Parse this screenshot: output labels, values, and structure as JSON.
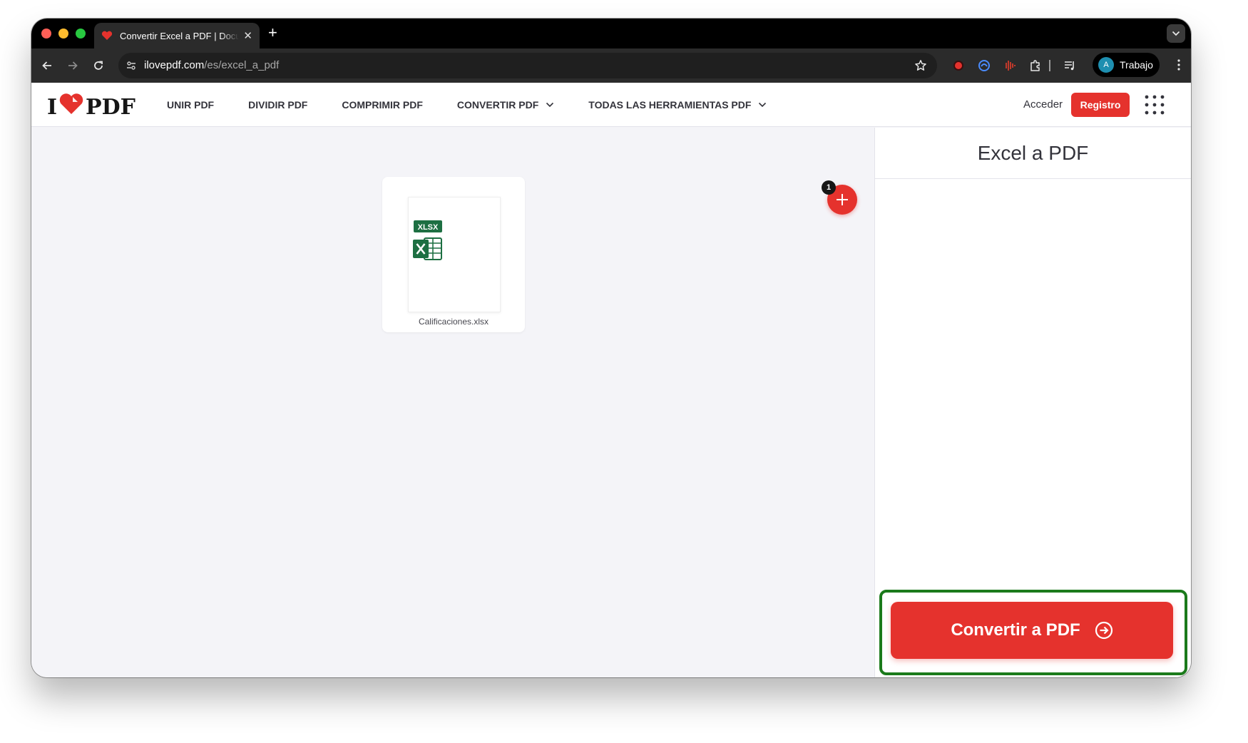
{
  "browser": {
    "tab_title": "Convertir Excel a PDF | Documentos Excel",
    "new_tab": "+",
    "tab_close": "✕",
    "url_domain": "ilovepdf.com",
    "url_path": "/es/excel_a_pdf",
    "profile_initial": "A",
    "profile_name": "Trabajo"
  },
  "header": {
    "logo_left": "I",
    "logo_right": "PDF",
    "nav": [
      {
        "label": "UNIR PDF"
      },
      {
        "label": "DIVIDIR PDF"
      },
      {
        "label": "COMPRIMIR PDF"
      },
      {
        "label": "CONVERTIR PDF"
      },
      {
        "label": "TODAS LAS HERRAMIENTAS PDF"
      }
    ],
    "login": "Acceder",
    "register": "Registro"
  },
  "workspace": {
    "file": {
      "badge": "XLSX",
      "name": "Calificaciones.xlsx"
    },
    "file_count": "1"
  },
  "panel": {
    "title": "Excel a PDF",
    "convert_label": "Convertir a PDF"
  },
  "colors": {
    "brand_red": "#e5322d",
    "excel_green": "#1d6f42",
    "highlight_green": "#1b7a1b"
  }
}
